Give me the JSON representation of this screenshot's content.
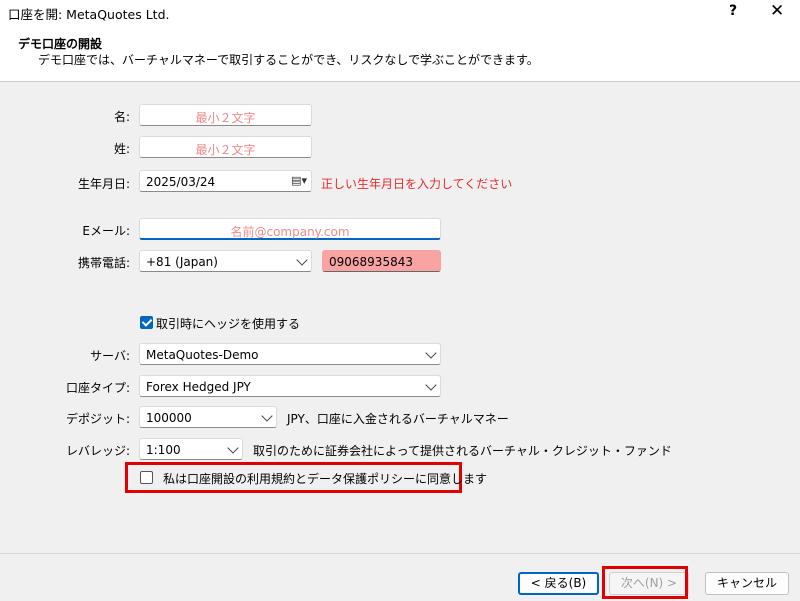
{
  "window": {
    "title": "口座を開: MetaQuotes Ltd.",
    "help": "?",
    "close": "✕"
  },
  "header": {
    "title": "デモ口座の開設",
    "subtitle": "デモ口座では、バーチャルマネーで取引することができ、リスクなしで学ぶことができます。"
  },
  "form": {
    "first_name": {
      "label": "名:",
      "placeholder": "最小２文字"
    },
    "last_name": {
      "label": "姓:",
      "placeholder": "最小２文字"
    },
    "birthdate": {
      "label": "生年月日:",
      "value": "2025/03/24",
      "error": "正しい生年月日を入力してください"
    },
    "email": {
      "label": "Eメール:",
      "placeholder": "名前@company.com"
    },
    "phone": {
      "label": "携帯電話:",
      "country": "+81 (Japan)",
      "number": "09068935843"
    },
    "hedge": {
      "label": "取引時にヘッジを使用する",
      "checked": true
    },
    "server": {
      "label": "サーバ:",
      "value": "MetaQuotes-Demo"
    },
    "account_type": {
      "label": "口座タイプ:",
      "value": "Forex Hedged JPY"
    },
    "deposit": {
      "label": "デポジット:",
      "value": "100000",
      "note": "JPY、口座に入金されるバーチャルマネー"
    },
    "leverage": {
      "label": "レバレッジ:",
      "value": "1:100",
      "note": "取引のために証券会社によって提供されるバーチャル・クレジット・ファンド"
    },
    "agreement": {
      "label": "私は口座開設の利用規約とデータ保護ポリシーに同意します",
      "checked": false
    }
  },
  "buttons": {
    "back": "< 戻る(B)",
    "next": "次へ(N) >",
    "cancel": "キャンセル"
  },
  "colors": {
    "accent": "#0067c0",
    "highlight": "#e00000",
    "error_text": "#e52b2b",
    "error_field": "#f9a3a3",
    "placeholder": "#f08a8a"
  },
  "icons": {
    "calendar": "calendar-icon",
    "dropdown": "chevron-down-icon",
    "check": "checkmark-icon"
  }
}
